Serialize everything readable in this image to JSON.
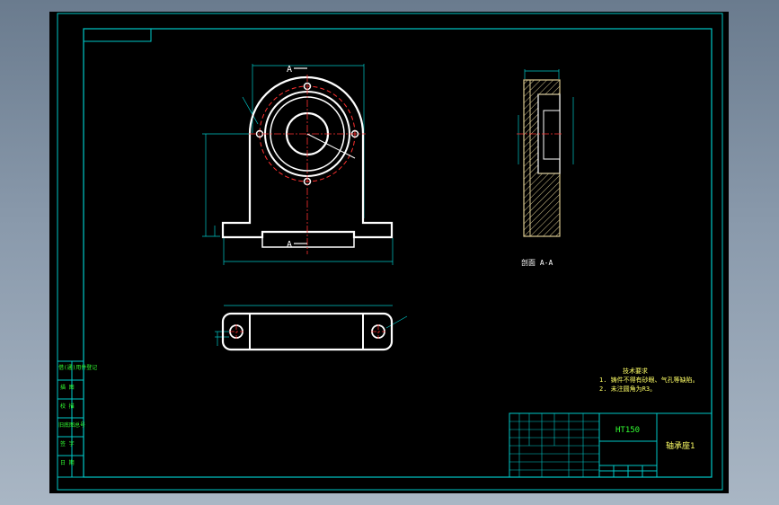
{
  "section_label": "A",
  "section_view_caption": "剖面 A-A",
  "tech_requirements": {
    "title": "技术要求",
    "line1": "1. 铸件不得有砂眼、气孔等缺陷。",
    "line2": "2. 未注圆角为R3。"
  },
  "material": "HT150",
  "part_name": "轴承座1",
  "side_labels": [
    "借(通)用件登记",
    "描 图",
    "校 描",
    "旧底图总号",
    "签 字",
    "日 期"
  ],
  "colors": {
    "background": "#000000",
    "frame": "#00c8c8",
    "outline": "#ffffff",
    "center": "#ff3030",
    "hatch": "#d8c890",
    "text": "#ffff66",
    "table_text": "#33ff33"
  }
}
